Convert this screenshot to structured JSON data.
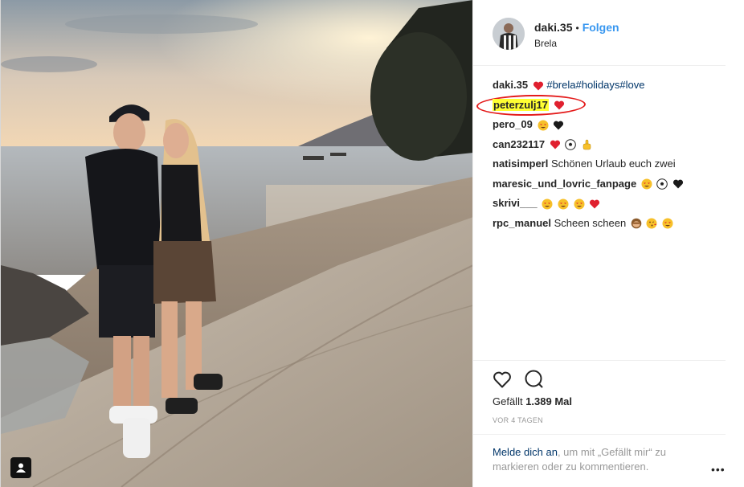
{
  "post": {
    "username": "daki.35",
    "separator": "•",
    "follow_label": "Folgen",
    "location": "Brela"
  },
  "caption": {
    "username": "daki.35",
    "hashtags": "#brela#holidays#love"
  },
  "comments": [
    {
      "username": "peterzulj17",
      "text": ""
    },
    {
      "username": "pero_09",
      "text": ""
    },
    {
      "username": "can232117",
      "text": ""
    },
    {
      "username": "natisimperl",
      "text": "Schönen Urlaub euch zwei"
    },
    {
      "username": "maresic_und_lovric_fanpage",
      "text": ""
    },
    {
      "username": "skrivi___",
      "text": ""
    },
    {
      "username": "rpc_manuel",
      "text": "Scheen scheen"
    }
  ],
  "likes": {
    "label": "Gefällt",
    "count": "1.389 Mal"
  },
  "time_ago": "VOR 4 TAGEN",
  "login_prompt": {
    "link": "Melde dich an",
    "rest": ", um mit „Gefällt mir“ zu markieren oder zu kommentieren."
  },
  "more_options": "•••",
  "icons": {
    "like": "heart-outline-icon",
    "comment": "speech-bubble-icon",
    "tag": "user-tag-icon"
  },
  "colors": {
    "link_blue": "#3897f0",
    "hashtag": "#003569",
    "highlight": "#ffff33",
    "annotation_red": "#e41c1c",
    "heart_red": "#e0202f"
  }
}
